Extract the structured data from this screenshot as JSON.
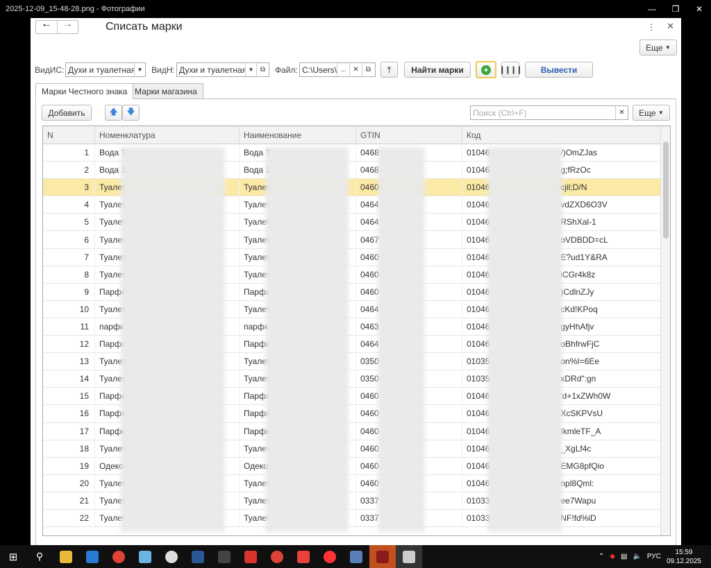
{
  "window": {
    "title": "2025-12-09_15-48-28.png - Фотографии"
  },
  "form": {
    "title": "Списать марки",
    "more_label": "Еще",
    "vid_is_label": "ВидИС:",
    "vid_is_value": "Духи и туалетная",
    "vid_n_label": "ВидН:",
    "vid_n_value": "Духи и туалетная",
    "file_label": "Файл:",
    "file_value": "C:\\Users\\",
    "file_more": "...",
    "find_button": "Найти марки",
    "output_button": "Вывести",
    "tabs": [
      "Марки Честного знака",
      "Марки магазина"
    ],
    "add_button": "Добавить",
    "search_placeholder": "Поиск (Ctrl+F)",
    "table_more_label": "Еще"
  },
  "table": {
    "columns": [
      "N",
      "Номенклатура",
      "Наименование",
      "GTIN",
      "Код"
    ],
    "rows": [
      [
        "1",
        "Вода Т",
        "Вода Т",
        "0468",
        "01046",
        "/)OmZJas"
      ],
      [
        "2",
        "Вода 1",
        "Вода 1",
        "0468",
        "01046",
        "g;fRzOc"
      ],
      [
        "3",
        "Туалет",
        "Туалет",
        "0460",
        "01046",
        "cjil;D/N"
      ],
      [
        "4",
        "Туалет",
        "Туалет",
        "0464",
        "01046",
        "vdZXD6O3V"
      ],
      [
        "5",
        "Туалет",
        "Туалет",
        "0464",
        "01046",
        "RShXal-1"
      ],
      [
        "6",
        "Туалет",
        "Туалет",
        "0467",
        "01046",
        "oVDBDD=cL"
      ],
      [
        "7",
        "Туалет",
        "Туалет",
        "0460",
        "01046",
        "E?ud1Y&RA"
      ],
      [
        "8",
        "Туалет",
        "Туалет",
        "0460",
        "01046",
        "iCGr4k8z"
      ],
      [
        "9",
        "Парфк",
        "Парфк",
        "0460",
        "01046",
        ")CdlnZJy"
      ],
      [
        "10",
        "Туалет",
        "Туалет",
        "0464",
        "01046",
        "cKd!KPoq"
      ],
      [
        "11",
        "парфк",
        "парфк",
        "0463",
        "01046",
        "gyHhAfjv"
      ],
      [
        "12",
        "Парфк",
        "Парфк",
        "0464",
        "01046",
        "oBhfrwFjC"
      ],
      [
        "13",
        "Туалет",
        "Туалет",
        "0350",
        "01035",
        "on%I=6Ee"
      ],
      [
        "14",
        "Туалет",
        "Туалет",
        "0350",
        "01035",
        "xDRd\":gn"
      ],
      [
        "15",
        "Парфк",
        "Парфк",
        "0460",
        "01046",
        "'d+1xZWh0W"
      ],
      [
        "16",
        "Парфк",
        "Парфк",
        "0460",
        "01046",
        "XcSKPVsU"
      ],
      [
        "17",
        "Парфк",
        "Парфк",
        "0460",
        "01046",
        "IkmleTF_A"
      ],
      [
        "18",
        "Туалет",
        "Туалет",
        "0460",
        "01046",
        "_XgLf4c"
      ],
      [
        "19",
        "Одеко",
        "Одеко",
        "0460",
        "01046",
        "EMG8pfQio"
      ],
      [
        "20",
        "Туалет",
        "Туалет",
        "0460",
        "01046",
        "npl8Qml:"
      ],
      [
        "21",
        "Туалет",
        "Туалет",
        "0337",
        "01033",
        "ee7Wapu"
      ],
      [
        "22",
        "Туалет",
        "Туалет",
        "0337",
        "01033",
        "NF!fd%iD"
      ]
    ]
  },
  "taskbar": {
    "lang": "РУС",
    "time": "15:59",
    "date": "09.12.2025"
  }
}
